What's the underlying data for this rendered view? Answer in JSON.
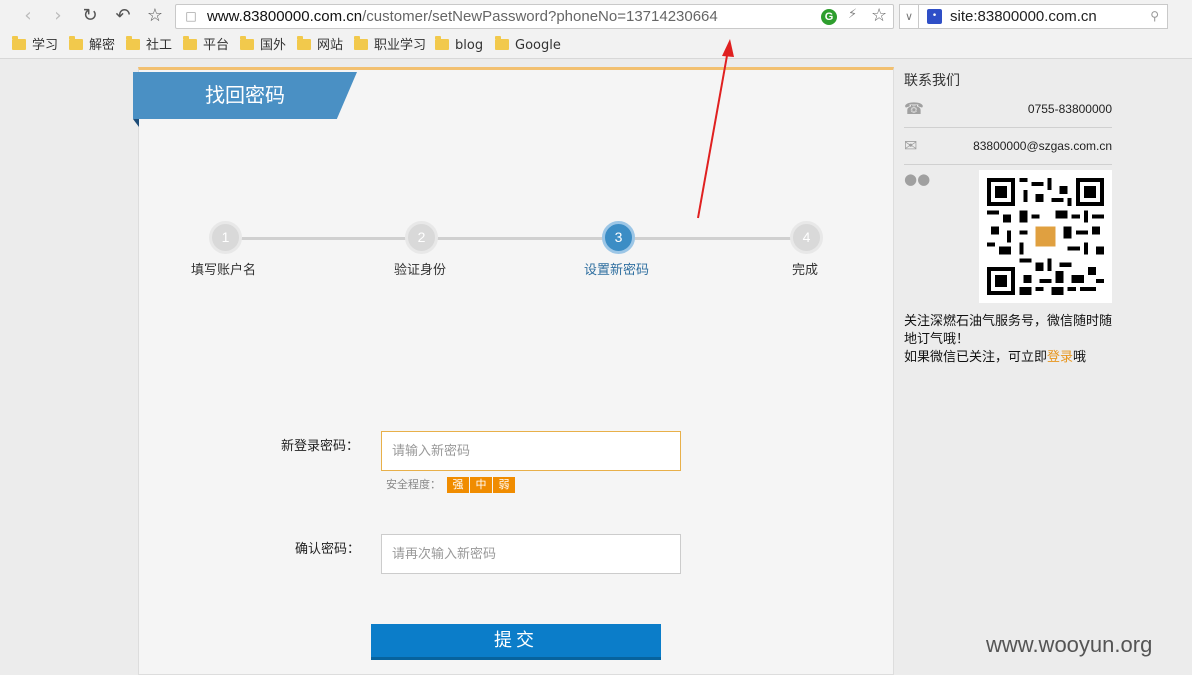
{
  "browser": {
    "url_host": "www.83800000.com.cn",
    "url_path": "/customer/setNewPassword?phoneNo=13714230664",
    "search_text": "site:83800000.com.cn",
    "bookmarks": [
      "学习",
      "解密",
      "社工",
      "平台",
      "国外",
      "网站",
      "职业学习",
      "blog",
      "Google"
    ]
  },
  "page": {
    "title": "找回密码",
    "steps": [
      {
        "num": "1",
        "label": "填写账户名"
      },
      {
        "num": "2",
        "label": "验证身份"
      },
      {
        "num": "3",
        "label": "设置新密码"
      },
      {
        "num": "4",
        "label": "完成"
      }
    ],
    "active_step": 3,
    "new_password_label": "新登录密码：",
    "new_password_placeholder": "请输入新密码",
    "strength_label": "安全程度：",
    "strength_levels": [
      "强",
      "中",
      "弱"
    ],
    "confirm_label": "确认密码：",
    "confirm_placeholder": "请再次输入新密码",
    "submit_label": "提交"
  },
  "sidebar": {
    "title": "联系我们",
    "phone": "0755-83800000",
    "email": "83800000@szgas.com.cn",
    "follow_text_1": "关注深燃石油气服务号，微信随时随地订气哦！",
    "follow_text_2": "如果微信已关注，可立即",
    "login_link": "登录",
    "follow_text_3": "哦"
  },
  "watermark": "www.wooyun.org",
  "colors": {
    "accent_blue": "#4a90c4",
    "submit_blue": "#0b7dc9",
    "strength_orange": "#f08c00",
    "annotation_red": "#e02020"
  }
}
